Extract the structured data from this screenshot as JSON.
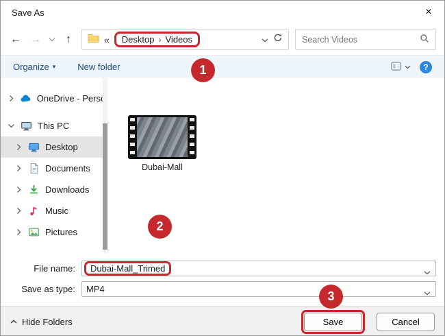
{
  "window": {
    "title": "Save As",
    "close_glyph": "×"
  },
  "icons": {
    "back": "←",
    "forward": "→",
    "up": "↑",
    "overflow": "«",
    "caret_down": "▾"
  },
  "nav": {
    "breadcrumb": {
      "items": [
        "Desktop",
        "Videos"
      ],
      "separator": "›"
    },
    "search": {
      "placeholder": "Search Videos"
    }
  },
  "toolbar": {
    "organize": "Organize",
    "new_folder": "New folder",
    "help": "?"
  },
  "sidebar": {
    "items": [
      {
        "label": "OneDrive - Perso",
        "expanded": false
      },
      {
        "label": "This PC",
        "expanded": true
      },
      {
        "label": "Desktop",
        "selected": true
      },
      {
        "label": "Documents"
      },
      {
        "label": "Downloads"
      },
      {
        "label": "Music"
      },
      {
        "label": "Pictures"
      }
    ]
  },
  "files": [
    {
      "name": "Dubai-Mall",
      "type": "video"
    }
  ],
  "fields": {
    "file_name_label": "File name:",
    "file_name_value": "Dubai-Mall_Trimed",
    "save_type_label": "Save as type:",
    "save_type_value": "MP4"
  },
  "footer": {
    "hide_folders": "Hide Folders",
    "save": "Save",
    "cancel": "Cancel"
  },
  "annotations": {
    "step1": "1",
    "step2": "2",
    "step3": "3"
  },
  "colors": {
    "annotation_red": "#c5292e",
    "accent_blue": "#2e86de",
    "command_bar_bg": "#eef6fc"
  }
}
